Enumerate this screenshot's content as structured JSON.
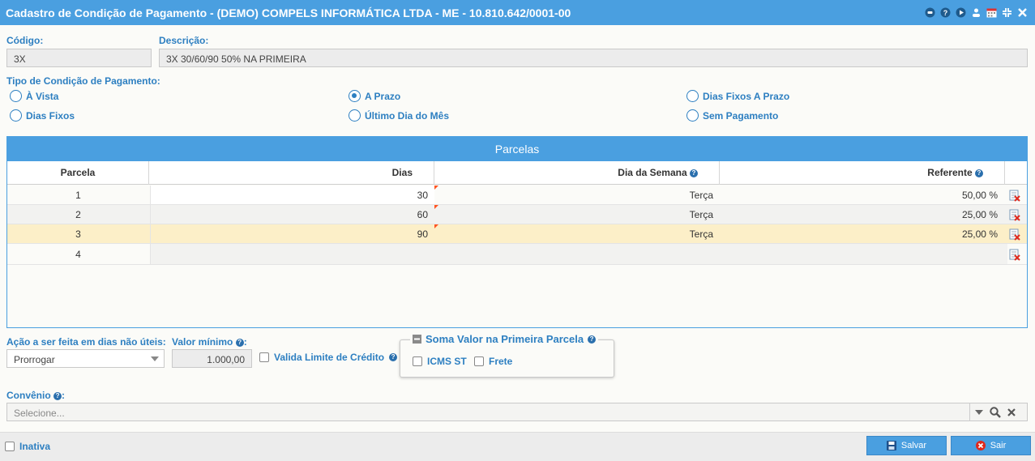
{
  "window": {
    "title": "Cadastro de Condição de Pagamento - (DEMO) COMPELS INFORMÁTICA LTDA - ME - 10.810.642/0001-00",
    "icons": [
      "record-icon",
      "help-icon",
      "play-icon",
      "user-icon",
      "calendar-icon",
      "shrink-icon",
      "close-icon"
    ]
  },
  "form": {
    "codigo_label": "Código:",
    "codigo_value": "3X",
    "descricao_label": "Descrição:",
    "descricao_value": "3X 30/60/90  50% NA PRIMEIRA",
    "tipo_label": "Tipo de Condição de Pagamento:",
    "tipos": [
      {
        "label": "À Vista",
        "selected": false
      },
      {
        "label": "Dias Fixos",
        "selected": false
      },
      {
        "label": "A Prazo",
        "selected": true
      },
      {
        "label": "Último Dia do Mês",
        "selected": false
      },
      {
        "label": "Dias Fixos A Prazo",
        "selected": false
      },
      {
        "label": "Sem Pagamento",
        "selected": false
      }
    ]
  },
  "grid": {
    "title": "Parcelas",
    "headers": {
      "parcela": "Parcela",
      "dias": "Dias",
      "dia_semana": "Dia da Semana",
      "referente": "Referente"
    },
    "rows": [
      {
        "parcela": "1",
        "dias": "30",
        "dia_semana": "Terça",
        "referente": "50,00 %"
      },
      {
        "parcela": "2",
        "dias": "60",
        "dia_semana": "Terça",
        "referente": "25,00 %"
      },
      {
        "parcela": "3",
        "dias": "90",
        "dia_semana": "Terça",
        "referente": "25,00 %"
      },
      {
        "parcela": "4",
        "dias": "",
        "dia_semana": "",
        "referente": ""
      }
    ],
    "highlight_color": "#fcefc8"
  },
  "options": {
    "acao_label": "Ação a ser feita em dias não úteis:",
    "acao_value": "Prorrogar",
    "valor_minimo_label": "Valor mínimo",
    "valor_minimo_suffix": ":",
    "valor_minimo_value": "1.000,00",
    "valida_limite_label": "Valida Limite de Crédito",
    "soma_title": "Soma Valor na Primeira Parcela",
    "icms_st_label": "ICMS ST",
    "frete_label": "Frete"
  },
  "convenio": {
    "label": "Convênio",
    "label_suffix": ":",
    "placeholder": "Selecione..."
  },
  "footer": {
    "inativa_label": "Inativa",
    "salvar_label": "Salvar",
    "sair_label": "Sair"
  },
  "colors": {
    "accent": "#4a9fe0",
    "label": "#2d7fc1"
  }
}
